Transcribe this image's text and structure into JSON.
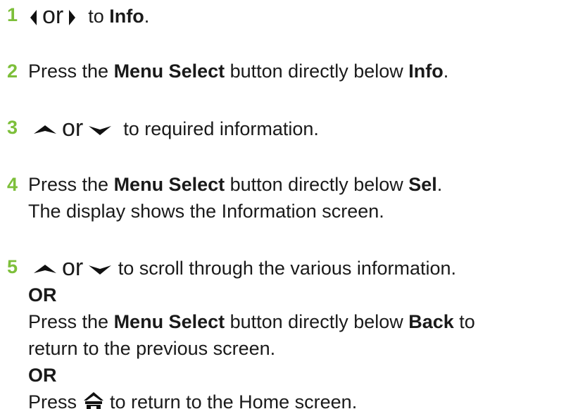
{
  "steps": [
    {
      "number": "1",
      "icon_left": "left-arrow-icon",
      "or": "or",
      "icon_right": "right-arrow-icon",
      "text_a": "to ",
      "bold_a": "Info",
      "text_b": "."
    },
    {
      "number": "2",
      "text_a": "Press the ",
      "bold_a": "Menu Select",
      "text_b": " button directly below ",
      "bold_b": "Info",
      "text_c": "."
    },
    {
      "number": "3",
      "icon_left": "up-arrow-icon",
      "or": "or",
      "icon_right": "down-arrow-icon",
      "text_a": "to required information."
    },
    {
      "number": "4",
      "text_a": "Press the ",
      "bold_a": "Menu Select",
      "text_b": " button directly below ",
      "bold_b": "Sel",
      "text_c": ".",
      "line2": "The display shows the Information screen."
    },
    {
      "number": "5",
      "icon_left": "up-arrow-icon",
      "or": "or",
      "icon_right": "down-arrow-icon",
      "text_a": "to scroll through the various information.",
      "or_bold_1": "OR",
      "press_text": "Press the ",
      "press_bold": "Menu Select",
      "press_mid": " button directly below ",
      "press_bold_2": "Back",
      "press_end": " to",
      "press_line2": "return to the previous screen.",
      "or_bold_2": "OR",
      "home_press": "Press ",
      "home_icon": "home-icon",
      "home_text": " to return to the Home screen."
    }
  ],
  "colors": {
    "step_number": "#7dbf3a",
    "text": "#1a1a1a"
  }
}
